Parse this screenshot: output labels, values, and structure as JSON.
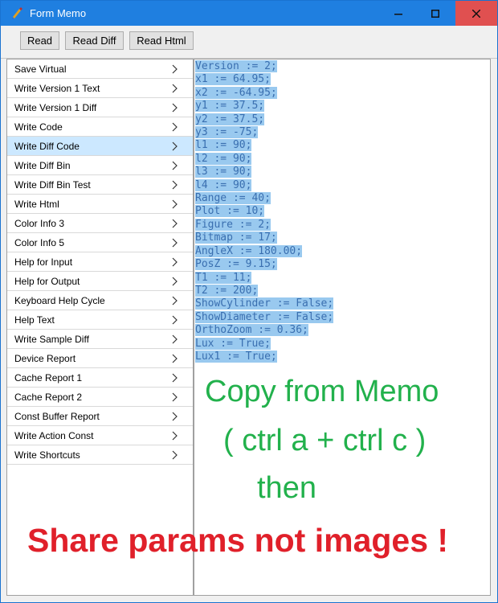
{
  "window": {
    "title": "Form Memo"
  },
  "toolbar": {
    "read": "Read",
    "read_diff": "Read Diff",
    "read_html": "Read Html"
  },
  "menu": {
    "items": [
      "Save Virtual",
      "Write Version 1 Text",
      "Write Version 1 Diff",
      "Write Code",
      "Write Diff Code",
      "Write Diff Bin",
      "Write Diff Bin Test",
      "Write Html",
      "Color Info 3",
      "Color Info 5",
      "Help for Input",
      "Help for Output",
      "Keyboard Help Cycle",
      "Help Text",
      "Write Sample Diff",
      "Device Report",
      "Cache Report 1",
      "Cache Report 2",
      "Const Buffer Report",
      "Write Action Const",
      "Write Shortcuts"
    ],
    "selected": "Write Diff Code"
  },
  "memo": {
    "lines": [
      "Version := 2;",
      "x1 := 64.95;",
      "x2 := -64.95;",
      "y1 := 37.5;",
      "y2 := 37.5;",
      "y3 := -75;",
      "l1 := 90;",
      "l2 := 90;",
      "l3 := 90;",
      "l4 := 90;",
      "Range := 40;",
      "Plot := 10;",
      "Figure := 2;",
      "Bitmap := 17;",
      "AngleX := 180.00;",
      "PosZ := 9.15;",
      "T1 := 11;",
      "T2 := 200;",
      "ShowCylinder := False;",
      "ShowDiameter := False;",
      "OrthoZoom := 0.36;",
      "Lux := True;",
      "Lux1 := True;"
    ]
  },
  "annotations": {
    "line1": "Copy from Memo",
    "line2": "( ctrl a + ctrl c )",
    "line3": "then",
    "line4": "Share params not images !"
  },
  "colors": {
    "titlebar": "#1f7fe0",
    "selection": "#99c9ef",
    "green_note": "#22b14c",
    "red_note": "#e0202a"
  },
  "icons": {
    "app": "paint-icon",
    "minimize": "minimize-icon",
    "maximize": "maximize-icon",
    "close": "close-icon",
    "chevron": "chevron-right-icon"
  }
}
